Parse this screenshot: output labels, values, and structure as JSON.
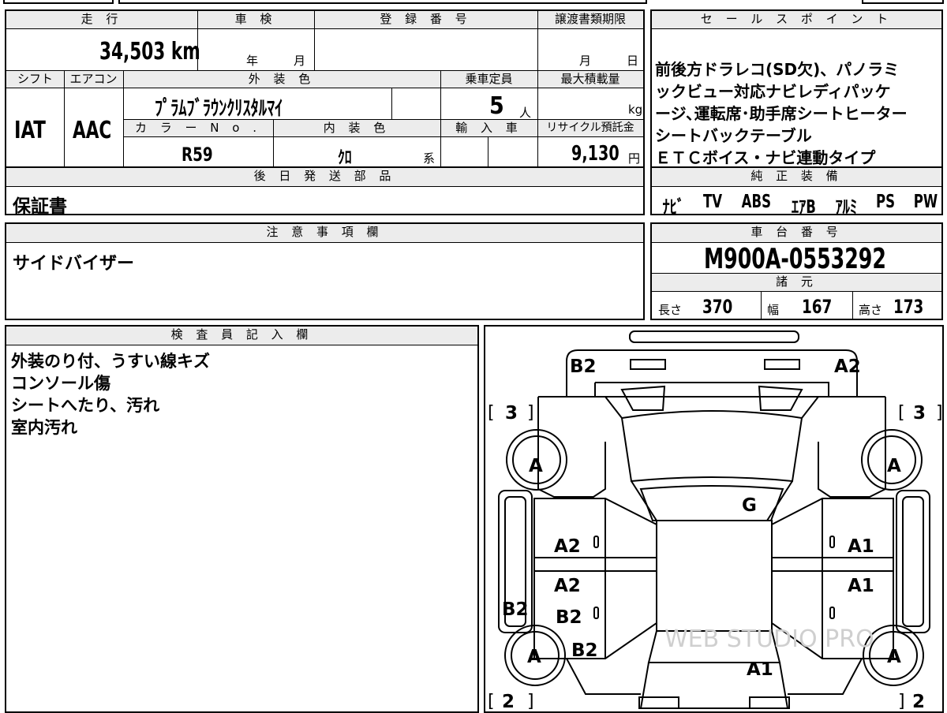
{
  "vehicle": {
    "mileage": {
      "label": "走 行",
      "value": "34,503 km"
    },
    "shaken": {
      "label": "車 検",
      "year_unit": "年",
      "month_unit": "月"
    },
    "registration": {
      "label": "登 録 番 号",
      "value": ""
    },
    "transfer_deadline": {
      "label": "譲渡書類期限",
      "month_unit": "月",
      "day_unit": "日"
    },
    "shift": {
      "label": "シフト",
      "value": "IAT"
    },
    "aircon": {
      "label": "エアコン",
      "value": "AAC"
    },
    "exterior_color": {
      "label": "外 装 色",
      "value": "ﾌﾟﾗﾑﾌﾞﾗｳﾝｸﾘｽﾀﾙﾏｲ"
    },
    "capacity": {
      "label": "乗車定員",
      "value": "5",
      "unit": "人"
    },
    "max_load": {
      "label": "最大積載量",
      "value": "",
      "unit": "kg"
    },
    "color_no": {
      "label": "カ ラ ー N o .",
      "value": "R59"
    },
    "interior_color": {
      "label": "内 装 色",
      "value": "ｸﾛ",
      "suffix": "系"
    },
    "import": {
      "label": "輸 入 車",
      "value": ""
    },
    "recycle": {
      "label": "リサイクル預託金",
      "value": "9,130",
      "unit": "円"
    }
  },
  "sales_points": {
    "label": "セ ー ル ス ポ イ ン ト",
    "lines": [
      "前後方ドラレコ(SD欠)、パノラミ",
      "ックビュー対応ナビレディパッケ",
      "ージ､運転席･助手席シートヒーター",
      "シートバックテーブル",
      "ＥＴＣボイス・ナビ連動タイプ"
    ]
  },
  "later_parts": {
    "label": "後 日 発 送 部 品",
    "value": "保証書"
  },
  "equipment": {
    "label": "純 正 装 備",
    "items": [
      "ﾅﾋﾞ",
      "TV",
      "ABS",
      "ｴｱB",
      "ｱﾙﾐ",
      "PS",
      "PW"
    ]
  },
  "notes": {
    "label": "注 意 事 項 欄",
    "value": "サイドバイザー"
  },
  "chassis": {
    "label": "車 台 番 号",
    "value": "M900A-0553292"
  },
  "specs": {
    "label": "諸 元",
    "length": {
      "label": "長さ",
      "value": "370"
    },
    "width": {
      "label": "幅",
      "value": "167"
    },
    "height": {
      "label": "高さ",
      "value": "173"
    }
  },
  "inspector": {
    "label": "検 査 員 記 入 欄",
    "lines": [
      "外装のり付、うすい線キズ",
      "コンソール傷",
      "シートへたり、汚れ",
      "室内汚れ"
    ]
  },
  "diagram": {
    "rating_front_left": "3",
    "rating_front_right": "3",
    "rating_rear_left": "2",
    "rating_rear_right": "2",
    "marks": {
      "front_left": "B2",
      "front_right": "A2",
      "tire_fl": "A",
      "tire_fr": "A",
      "tire_rl": "A",
      "tire_rr": "A",
      "windshield": "G",
      "door_fl": "A2",
      "door_fr": "A1",
      "door_rl_upper": "A2",
      "door_rr_upper": "A1",
      "door_rl_lower": "B2",
      "sill_left": "B2",
      "quarter_left": "B2",
      "rear": "A1"
    },
    "watermark": "WEB STUDIO PRO"
  }
}
